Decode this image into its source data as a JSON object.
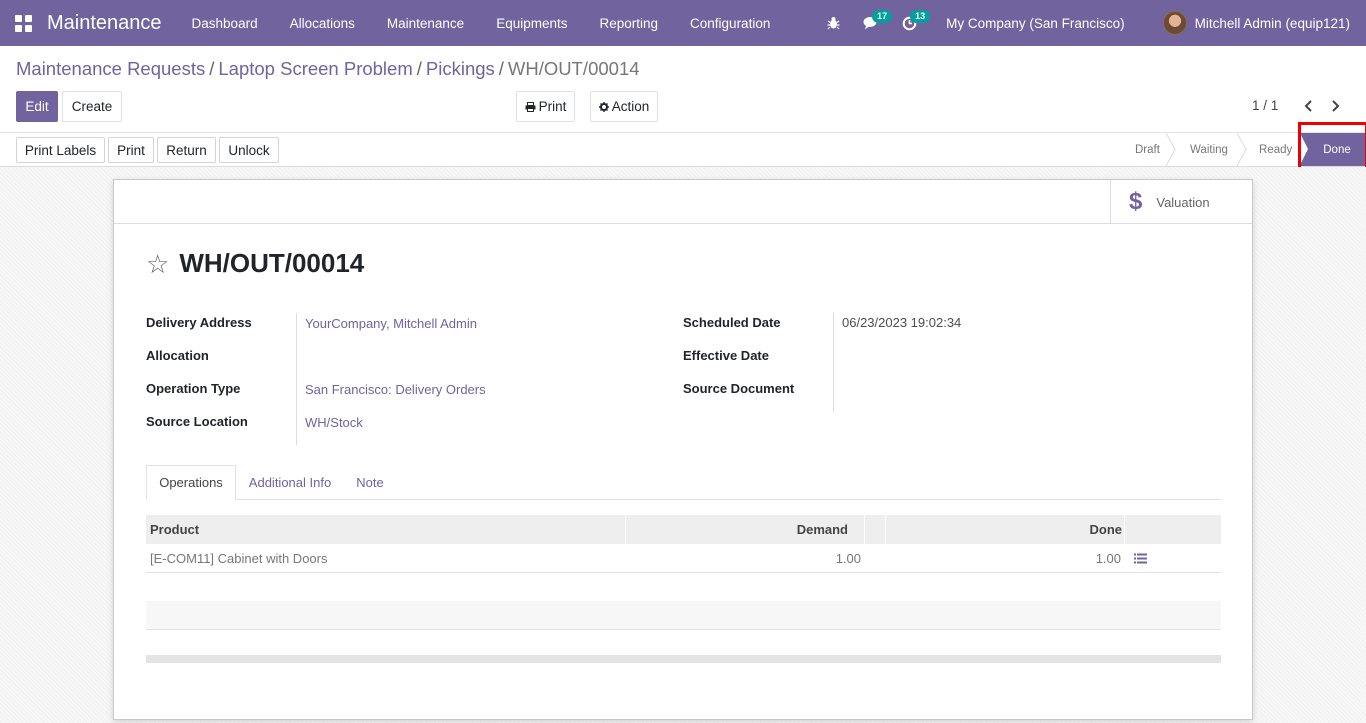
{
  "navbar": {
    "app_name": "Maintenance",
    "menu": [
      "Dashboard",
      "Allocations",
      "Maintenance",
      "Equipments",
      "Reporting",
      "Configuration"
    ],
    "messages_count": "17",
    "activities_count": "13",
    "company": "My Company (San Francisco)",
    "user": "Mitchell Admin (equip121)"
  },
  "breadcrumb": {
    "items": [
      "Maintenance Requests",
      "Laptop Screen Problem",
      "Pickings"
    ],
    "separator": "/",
    "current": "WH/OUT/00014"
  },
  "control_panel": {
    "edit_label": "Edit",
    "create_label": "Create",
    "print_label": "Print",
    "action_label": "Action",
    "pager": "1 / 1"
  },
  "statusbar": {
    "buttons": [
      "Print Labels",
      "Print",
      "Return",
      "Unlock"
    ],
    "stages": [
      "Draft",
      "Waiting",
      "Ready",
      "Done"
    ],
    "active_stage": "Done"
  },
  "sheet": {
    "valuation_label": "Valuation",
    "title": "WH/OUT/00014",
    "left_fields": [
      {
        "label": "Delivery Address",
        "value": "YourCompany, Mitchell Admin"
      },
      {
        "label": "Allocation",
        "value": ""
      },
      {
        "label": "Operation Type",
        "value": "San Francisco: Delivery Orders"
      },
      {
        "label": "Source Location",
        "value": "WH/Stock"
      }
    ],
    "right_fields": [
      {
        "label": "Scheduled Date",
        "value": "06/23/2023 19:02:34"
      },
      {
        "label": "Effective Date",
        "value": ""
      },
      {
        "label": "Source Document",
        "value": ""
      }
    ],
    "tabs": [
      "Operations",
      "Additional Info",
      "Note"
    ],
    "active_tab": "Operations"
  },
  "operations_table": {
    "columns": [
      "Product",
      "Demand",
      "Done"
    ],
    "rows": [
      {
        "product": "[E-COM11] Cabinet with Doors",
        "demand": "1.00",
        "done": "1.00"
      }
    ]
  },
  "colors": {
    "brand": "#71639e",
    "badge": "#00a09d",
    "highlight": "#e00000"
  }
}
